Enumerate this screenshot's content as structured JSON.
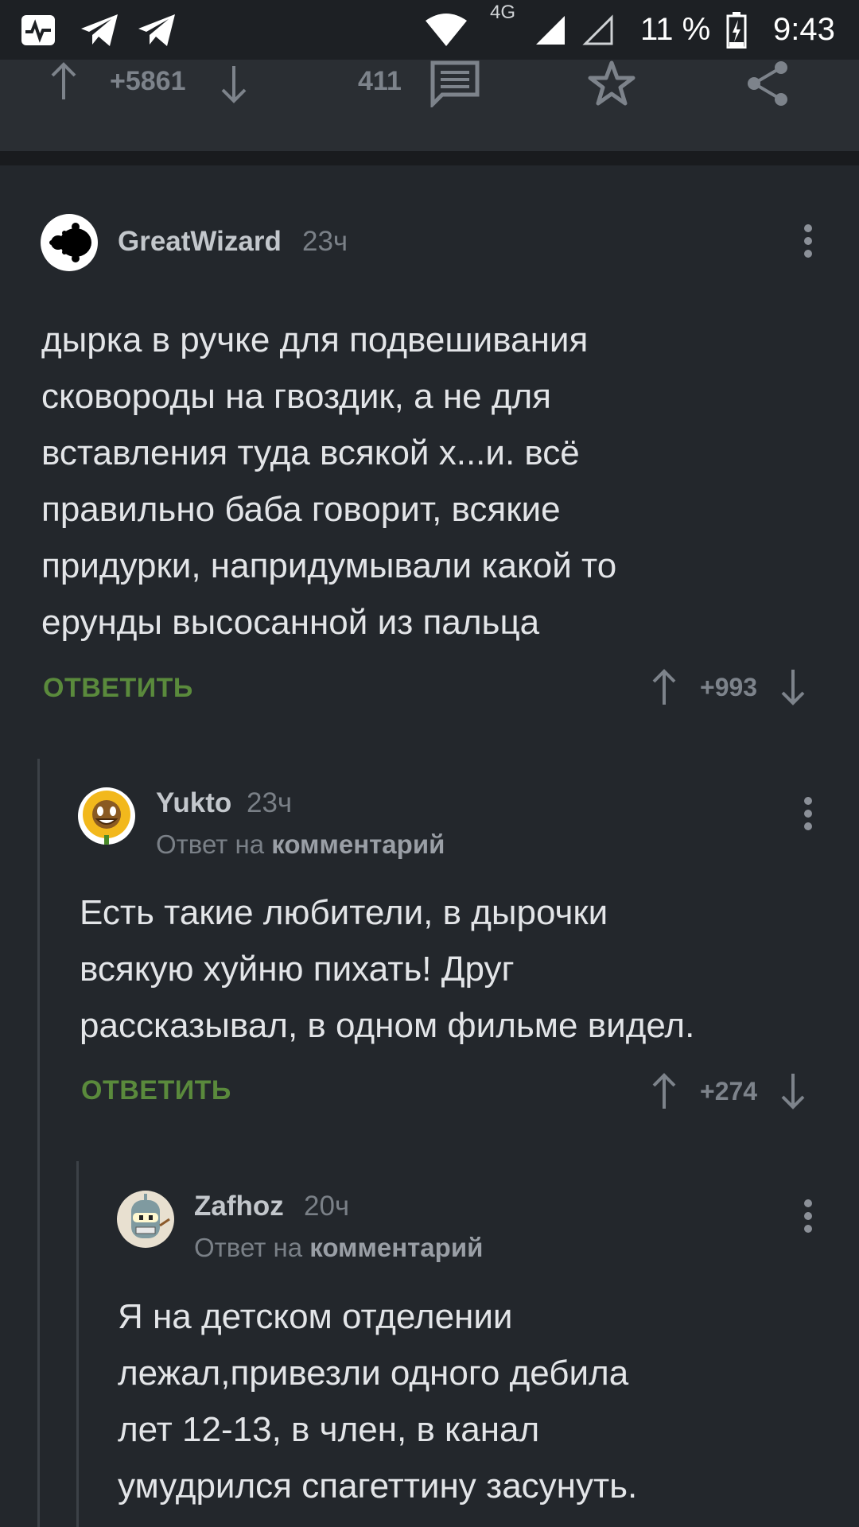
{
  "status_bar": {
    "network_label": "4G",
    "battery": "11 %",
    "time": "9:43"
  },
  "post_bar": {
    "rating": "+5861",
    "comments_count": "411"
  },
  "comments": [
    {
      "author": "GreatWizard",
      "time": "23ч",
      "text_lines": [
        "дырка в ручке для подвешивания",
        "сковороды на гвоздик, а не для",
        "вставления туда всякой х...и. всё",
        "правильно баба говорит, всякие",
        "придурки, напридумывали какой то",
        "ерунды высосанной из пальца"
      ],
      "reply_label": "ОТВЕТИТЬ",
      "rating": "+993"
    },
    {
      "author": "Yukto",
      "time": "23ч",
      "reply_prefix": "Ответ на",
      "reply_target": "комментарий",
      "text_lines": [
        "Есть такие любители, в дырочки",
        "всякую хуйню пихать! Друг",
        "рассказывал, в одном фильме видел."
      ],
      "reply_label": "ОТВЕТИТЬ",
      "rating": "+274"
    },
    {
      "author": "Zafhoz",
      "time": "20ч",
      "reply_prefix": "Ответ на",
      "reply_target": "комментарий",
      "text_lines": [
        "Я на детском отделении",
        "лежал,привезли одного дебила",
        "лет 12-13, в член, в канал",
        "умудрился спагеттину засунуть."
      ]
    }
  ],
  "icons": {
    "status": [
      "activity-icon",
      "telegram-icon",
      "telegram-icon",
      "wifi-icon",
      "signal-icon",
      "signal-empty-icon",
      "battery-charging-icon"
    ],
    "post": [
      "upvote-arrow-icon",
      "downvote-arrow-icon",
      "comment-icon",
      "star-icon",
      "share-icon"
    ]
  },
  "colors": {
    "background": "#23272c",
    "reply_green": "#5a8a3c",
    "muted": "#7d838b"
  }
}
